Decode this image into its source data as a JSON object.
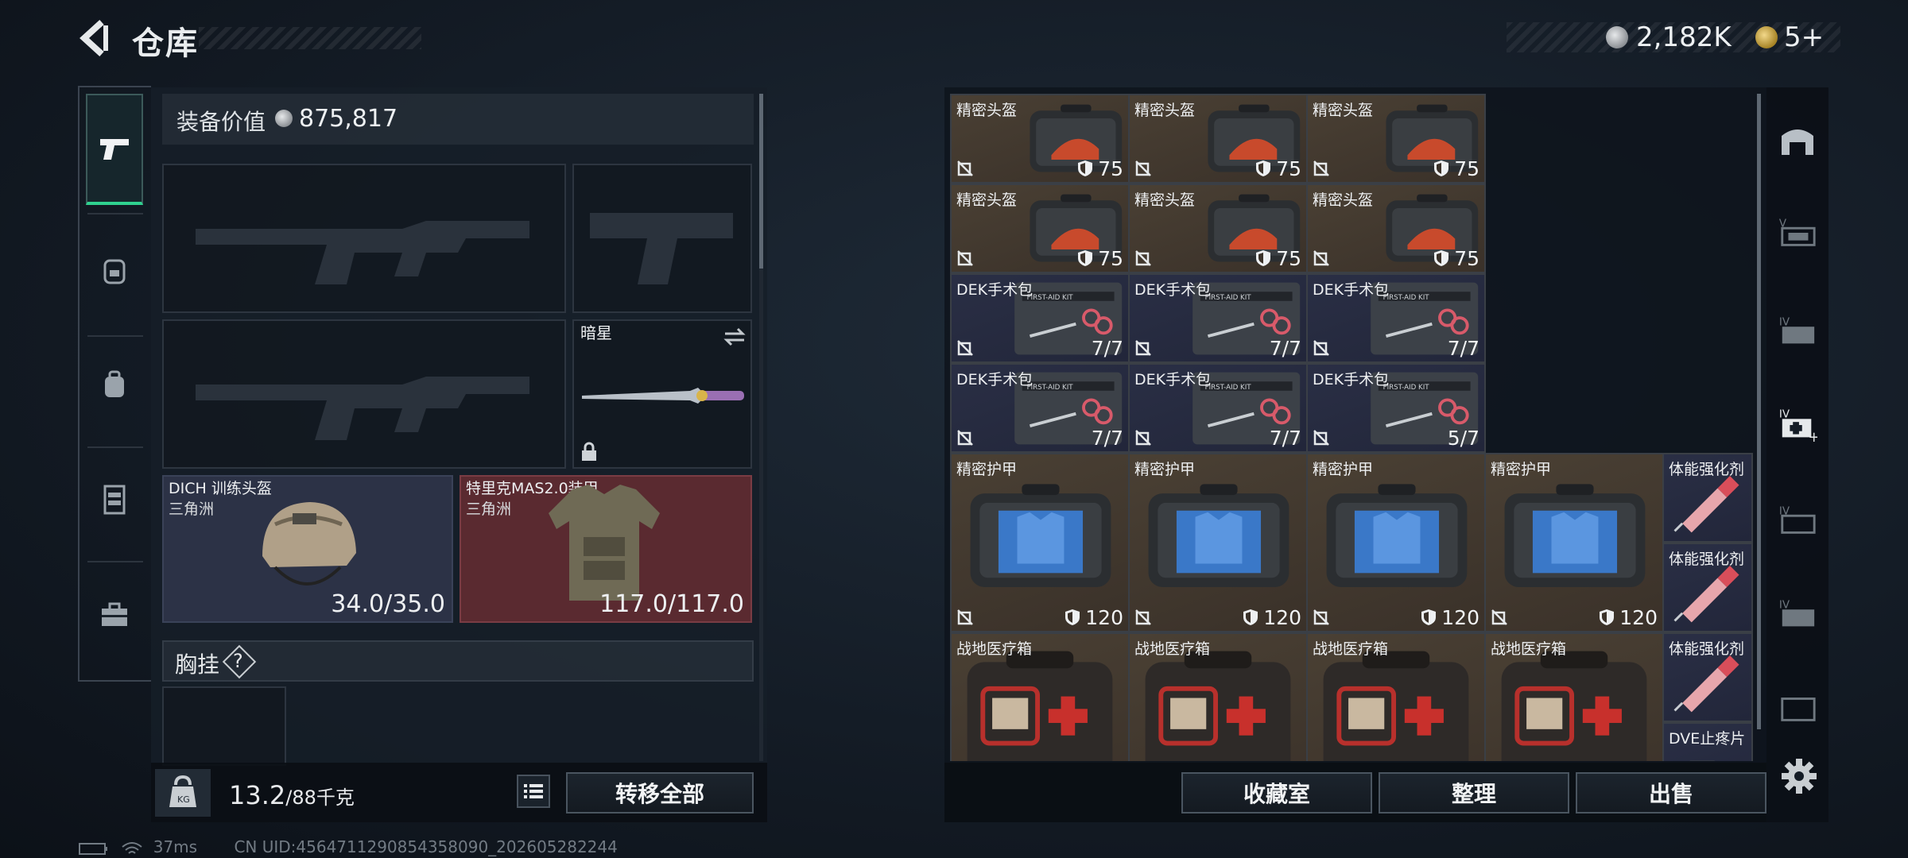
{
  "header": {
    "title": "仓库",
    "currency_silver": "2,182K",
    "currency_gold": "5+"
  },
  "equipment": {
    "value_label": "装备价值",
    "value": "875,817",
    "knife_name": "暗星",
    "helmet": {
      "name": "DICH 训练头盔",
      "source": "三角洲",
      "durability": "34.0/35.0"
    },
    "armor": {
      "name": "特里克MAS2.0装甲",
      "source": "三角洲",
      "durability": "117.0/117.0"
    },
    "chest_label": "胸挂",
    "chest_help": "?"
  },
  "weight": {
    "current": "13.2",
    "max": "/88千克"
  },
  "buttons": {
    "transfer_all": "转移全部",
    "collection": "收藏室",
    "organize": "整理",
    "sell": "出售"
  },
  "grid_items": [
    {
      "name": "精密头盔",
      "value": "75",
      "color": "brown",
      "kind": "helmet-bag"
    },
    {
      "name": "精密头盔",
      "value": "75",
      "color": "brown",
      "kind": "helmet-bag"
    },
    {
      "name": "精密头盔",
      "value": "75",
      "color": "brown",
      "kind": "helmet-bag"
    },
    {
      "name": "精密头盔",
      "value": "75",
      "color": "brown",
      "kind": "helmet-bag"
    },
    {
      "name": "精密头盔",
      "value": "75",
      "color": "brown",
      "kind": "helmet-bag"
    },
    {
      "name": "精密头盔",
      "value": "75",
      "color": "brown",
      "kind": "helmet-bag"
    },
    {
      "name": "DEK手术包",
      "value": "7/7",
      "color": "navy",
      "kind": "surgery-kit"
    },
    {
      "name": "DEK手术包",
      "value": "7/7",
      "color": "navy",
      "kind": "surgery-kit"
    },
    {
      "name": "DEK手术包",
      "value": "7/7",
      "color": "navy",
      "kind": "surgery-kit"
    },
    {
      "name": "DEK手术包",
      "value": "7/7",
      "color": "navy",
      "kind": "surgery-kit"
    },
    {
      "name": "DEK手术包",
      "value": "7/7",
      "color": "navy",
      "kind": "surgery-kit"
    },
    {
      "name": "DEK手术包",
      "value": "5/7",
      "color": "navy",
      "kind": "surgery-kit"
    },
    {
      "name": "精密护甲",
      "value": "120",
      "color": "brown",
      "kind": "armor-bag"
    },
    {
      "name": "精密护甲",
      "value": "120",
      "color": "brown",
      "kind": "armor-bag"
    },
    {
      "name": "精密护甲",
      "value": "120",
      "color": "brown",
      "kind": "armor-bag"
    },
    {
      "name": "精密护甲",
      "value": "120",
      "color": "brown",
      "kind": "armor-bag"
    },
    {
      "name": "体能强化剂",
      "value": "",
      "color": "navy",
      "kind": "syringe"
    },
    {
      "name": "体能强化剂",
      "value": "",
      "color": "navy",
      "kind": "syringe"
    },
    {
      "name": "战地医疗箱",
      "value": "",
      "color": "brown",
      "kind": "medkit"
    },
    {
      "name": "战地医疗箱",
      "value": "",
      "color": "brown",
      "kind": "medkit"
    },
    {
      "name": "战地医疗箱",
      "value": "",
      "color": "brown",
      "kind": "medkit"
    },
    {
      "name": "战地医疗箱",
      "value": "",
      "color": "brown",
      "kind": "medkit"
    },
    {
      "name": "体能强化剂",
      "value": "",
      "color": "navy",
      "kind": "syringe"
    },
    {
      "name": "DVE止疼片",
      "value": "",
      "color": "navy",
      "kind": "pills"
    }
  ],
  "status": {
    "ping": "37ms",
    "uid": "CN UID:456471129085435809‌0_202605282244"
  },
  "colors": {
    "accent_green": "#2fd18f",
    "armor_red": "#5a2a30",
    "helmet_navy": "#2c3246"
  }
}
